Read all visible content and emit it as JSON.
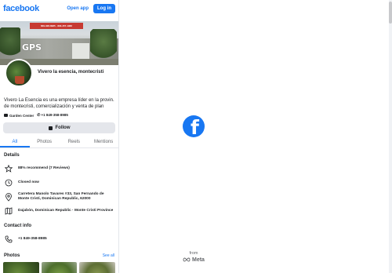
{
  "header": {
    "logo": "facebook",
    "open_app": "Open app",
    "login": "Log in"
  },
  "cover": {
    "sign_text": "809-328-8985 · 829-457-1982",
    "sign_brand": "GPS"
  },
  "page": {
    "name": "Vivero la esencia, montecristi",
    "description": "Vivero La Esencia es una empresa líder en la provin. de montecristi, comercialización y venta de plan",
    "category": "Garden Center",
    "phone_short": "+1 849-358-8985",
    "follow": "Follow"
  },
  "tabs": [
    "All",
    "Photos",
    "Reels",
    "Mentions"
  ],
  "details": {
    "title": "Details",
    "items": [
      {
        "icon": "star-icon",
        "text": "88% recommend (7 Reviews)"
      },
      {
        "icon": "clock-icon",
        "text": "Closed now"
      },
      {
        "icon": "location-pin-icon",
        "text": "Carretera Manolo Tavares #33, San Fernando de Monte Cristi, Dominican Republic, 62000"
      },
      {
        "icon": "map-icon",
        "text": "Dajabón, Dominican Republic · Monte Cristi Province"
      }
    ]
  },
  "contact": {
    "title": "Contact info",
    "phone": "+1 849-358-8985"
  },
  "photos": {
    "title": "Photos",
    "see_all": "See all"
  },
  "footer": {
    "from": "from",
    "meta": "Meta"
  },
  "colors": {
    "brand": "#1877f2",
    "text": "#1c1e21",
    "muted": "#65676b",
    "button_bg": "#e4e6eb"
  }
}
